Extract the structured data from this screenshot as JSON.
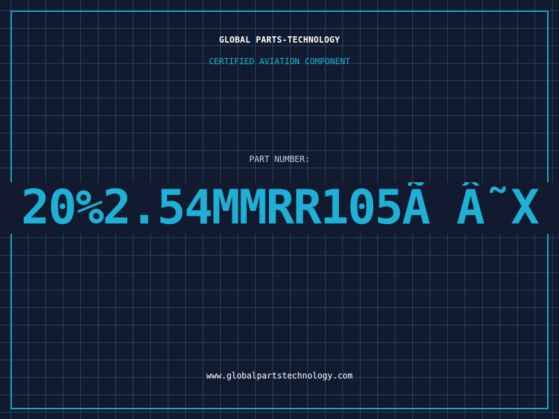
{
  "header": {
    "company_name": "GLOBAL PARTS-TECHNOLOGY",
    "tagline": "CERTIFIED AVIATION COMPONENT"
  },
  "part": {
    "label": "PART NUMBER:",
    "number": "20%2.54MMRR105Ã Â˜X"
  },
  "footer": {
    "website": "www.globalpartstechnology.com"
  },
  "colors": {
    "background": "#111a2e",
    "grid": "#286e82",
    "accent": "#1fb0d6",
    "text_light": "#ffffff"
  }
}
